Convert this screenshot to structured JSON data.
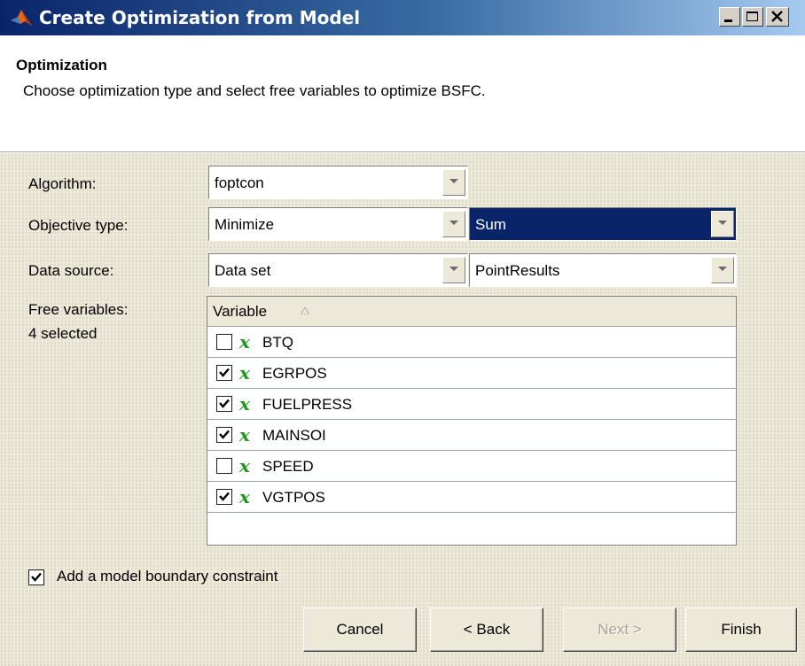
{
  "window": {
    "title": "Create Optimization from Model",
    "controls": [
      "minimize-icon",
      "maximize-icon",
      "close-icon"
    ]
  },
  "header": {
    "title": "Optimization",
    "subtitle": "Choose optimization type and select free variables to optimize BSFC."
  },
  "form": {
    "algorithm_label": "Algorithm:",
    "algorithm_value": "foptcon",
    "objective_label": "Objective type:",
    "objective_value": "Minimize",
    "objective_agg_value": "Sum",
    "datasource_label": "Data source:",
    "datasource_value": "Data set",
    "datasource_set_value": "PointResults",
    "freevars_label": "Free variables:",
    "freevars_count": "4 selected"
  },
  "table": {
    "column_header": "Variable",
    "rows": [
      {
        "name": "BTQ",
        "checked": false
      },
      {
        "name": "EGRPOS",
        "checked": true
      },
      {
        "name": "FUELPRESS",
        "checked": true
      },
      {
        "name": "MAINSOI",
        "checked": true
      },
      {
        "name": "SPEED",
        "checked": false
      },
      {
        "name": "VGTPOS",
        "checked": true
      }
    ],
    "var_icon_glyph": "x"
  },
  "constraint": {
    "label": "Add a model boundary constraint",
    "checked": true
  },
  "buttons": {
    "cancel": "Cancel",
    "back": "< Back",
    "next": "Next >",
    "finish": "Finish"
  },
  "colors": {
    "title_bar": "#0a246a",
    "selected_combo": "#0a246a",
    "var_icon": "#1a9c1a",
    "dialog_bg": "#ece9d8"
  }
}
